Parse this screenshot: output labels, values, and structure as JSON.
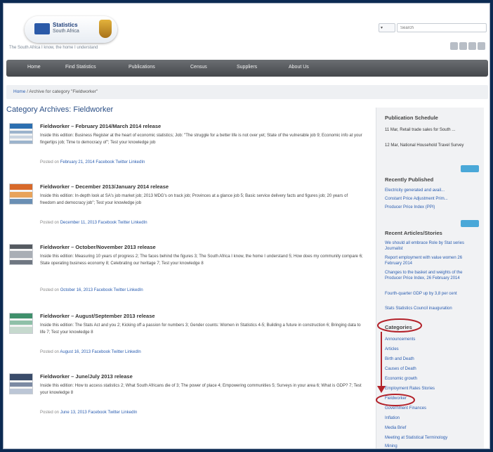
{
  "header": {
    "logo_text": "Statistics",
    "logo_subtext": "South Africa",
    "tagline": "The South Africa I know, the home I understand",
    "lang": "▾",
    "search_placeholder": "Search"
  },
  "social_icons": [
    "facebook-icon",
    "twitter-icon",
    "linkedin-icon",
    "rss-icon"
  ],
  "nav": [
    "Home",
    "Find Statistics",
    "Publications",
    "Census",
    "Suppliers",
    "About Us"
  ],
  "breadcrumb": {
    "home": "Home",
    "current": "Archive for category \"Fieldworker\""
  },
  "page_title": "Category Archives: Fieldworker",
  "posts": [
    {
      "title": "Fieldworker – February 2014/March 2014 release",
      "excerpt": "Inside this edition: Business Register at the heart of economic statistics; Job: \"The struggle for a better life is not over yet; State of the vulnerable job 9; Economic info at your fingertips job; Time to democracy of\"; Test your knowledge job",
      "meta_prefix": "Posted on",
      "date": "February 21, 2014",
      "links": [
        "Facebook",
        "Twitter",
        "LinkedIn"
      ]
    },
    {
      "title": "Fieldworker – December 2013/January 2014 release",
      "excerpt": "Inside this edition: In-depth look at SA's job market job; 2013 MDG's on track job; Provinces at a glance job 5; Basic service delivery facts and figures job; 20 years of freedom and democracy job\"; Test your knowledge job",
      "meta_prefix": "Posted on",
      "date": "December 11, 2013",
      "links": [
        "Facebook",
        "Twitter",
        "LinkedIn"
      ]
    },
    {
      "title": "Fieldworker – October/November 2013 release",
      "excerpt": "Inside this edition: Measuring 10 years of progress 2; The faces behind the figures 3; The South Africa I know, the home I understand 5; How does my community compare 6; State operating business economy 8; Celebrating our heritage 7; Test your knowledge 8",
      "meta_prefix": "Posted on",
      "date": "October 16, 2013",
      "links": [
        "Facebook",
        "Twitter",
        "LinkedIn"
      ]
    },
    {
      "title": "Fieldworker – August/September 2013 release",
      "excerpt": "Inside this edition: The Stats Act and you 2; Kicking off a passion for numbers 3; Gender counts: Women in Statistics 4-5; Building a future in construction 6; Bringing data to life 7; Test your knowledge 8",
      "meta_prefix": "Posted on",
      "date": "August 16, 2013",
      "links": [
        "Facebook",
        "Twitter",
        "LinkedIn"
      ]
    },
    {
      "title": "Fieldworker – June/July 2013 release",
      "excerpt": "Inside this edition: How to access statistics 2; What South Africans die of 3; The power of place 4; Empowering communities 5; Surveys in your area 6; What is GDP? 7; Test your knowledge 8",
      "meta_prefix": "Posted on",
      "date": "June 13, 2013",
      "links": [
        "Facebook",
        "Twitter",
        "LinkedIn"
      ]
    }
  ],
  "sidebar": {
    "schedule": {
      "title": "Publication Schedule",
      "items": [
        "11 Mar, Retail trade sales for South ...",
        "12 Mar, National Household Travel Survey"
      ]
    },
    "recent_published": {
      "title": "Recently Published",
      "items": [
        "Electricity generated and avail...",
        "Constant Price Adjustment Prim...",
        "Producer Price Index (PPI)"
      ]
    },
    "articles": {
      "title": "Recent Articles/Stories",
      "items": [
        "We should all embrace Role by Stat series Journalist",
        "Report employment with value women 26 February 2014",
        "Changes to the basket and weights of the Producer Price Index, 26 February 2014",
        "Fourth-quarter GDP up by 3,8 per cent",
        "Stats Statistics Council inauguration"
      ]
    },
    "categories": {
      "title": "Categories",
      "items": [
        "Announcements",
        "Articles",
        "Birth and Death",
        "Causes of Death",
        "Economic growth",
        "Employment Rates Stories",
        "Fieldworker",
        "Government Finances",
        "Inflation",
        "Media Brief",
        "Meeting at Statistical Terminology",
        "Mining"
      ]
    }
  },
  "annotation_color": "#b3222a"
}
